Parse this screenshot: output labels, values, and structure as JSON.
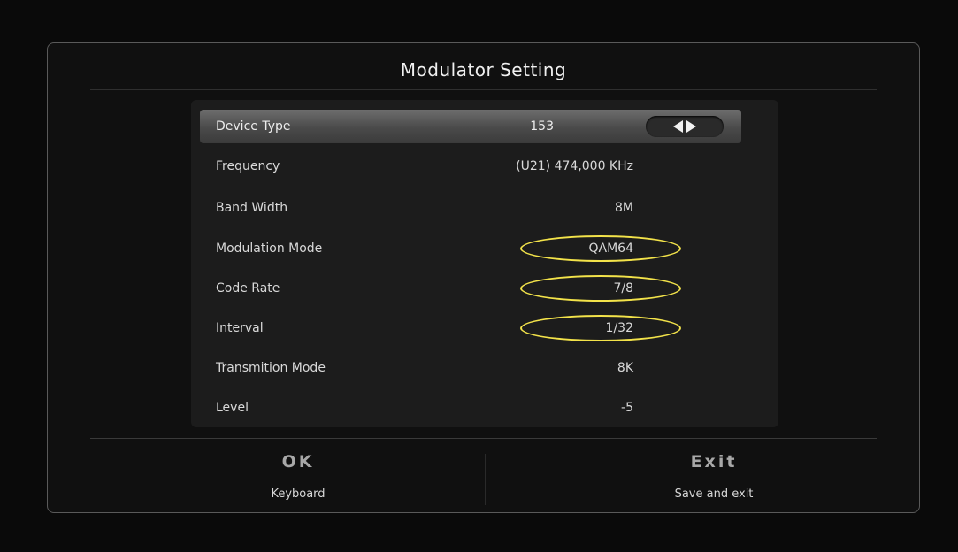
{
  "header": {
    "title": "Modulator Setting"
  },
  "settings": [
    {
      "label": "Device Type",
      "value": "153"
    },
    {
      "label": "Frequency",
      "value": "(U21) 474,000 KHz"
    },
    {
      "label": "Band Width",
      "value": "8M"
    },
    {
      "label": "Modulation Mode",
      "value": "QAM64"
    },
    {
      "label": "Code Rate",
      "value": "7/8"
    },
    {
      "label": "Interval",
      "value": "1/32"
    },
    {
      "label": "Transmition Mode",
      "value": "8K"
    },
    {
      "label": "Level",
      "value": "-5"
    }
  ],
  "footer": {
    "ok_key": "OK",
    "ok_desc": "Keyboard",
    "exit_key": "Exit",
    "exit_desc": "Save and exit"
  },
  "icons": {
    "left": "arrow-left-icon",
    "right": "arrow-right-icon"
  },
  "colors": {
    "highlight_ring": "#f3e34a",
    "background": "#0a0a0a"
  }
}
